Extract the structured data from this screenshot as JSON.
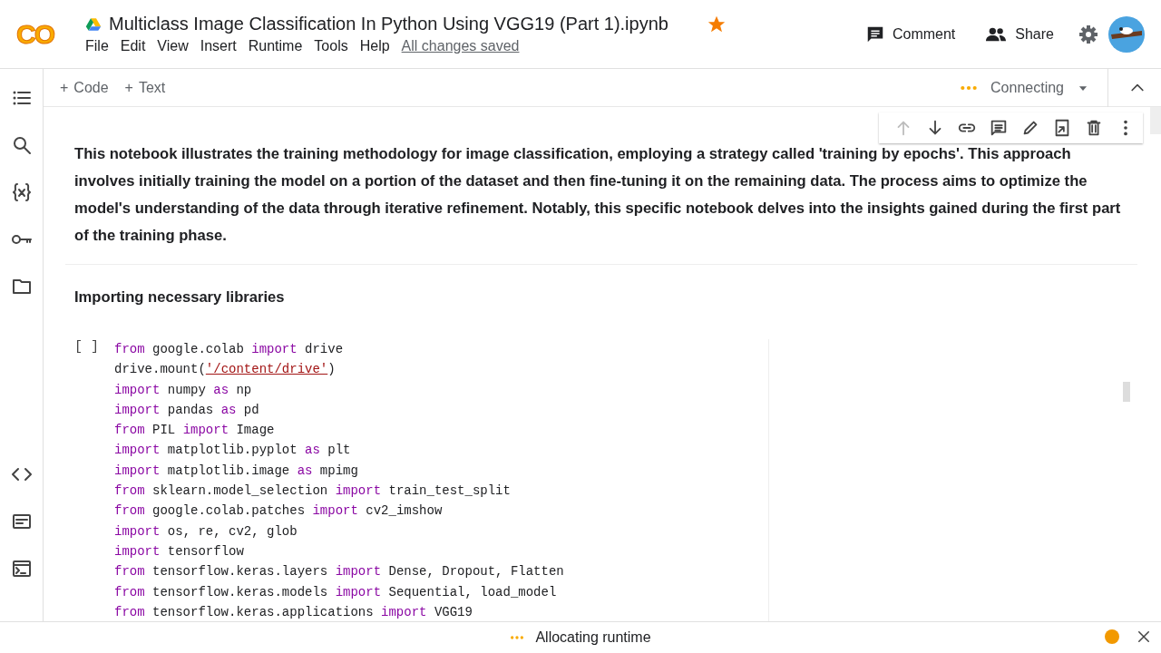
{
  "header": {
    "logo": "CO",
    "title": "Multiclass Image Classification In Python Using VGG19 (Part 1).ipynb",
    "starred": true,
    "menu": [
      "File",
      "Edit",
      "View",
      "Insert",
      "Runtime",
      "Tools",
      "Help"
    ],
    "save_status": "All changes saved",
    "actions": [
      {
        "kind": "comment",
        "label": "Comment"
      },
      {
        "kind": "share",
        "label": "Share"
      }
    ]
  },
  "toolbar": {
    "buttons": [
      {
        "icon": "+",
        "label": "Code"
      },
      {
        "icon": "+",
        "label": "Text"
      }
    ],
    "runtime": "Connecting"
  },
  "cell_toolbar": [
    {
      "kind": "up",
      "disabled": true
    },
    {
      "kind": "down",
      "disabled": false
    },
    {
      "kind": "link",
      "disabled": false
    },
    {
      "kind": "comment",
      "disabled": false
    },
    {
      "kind": "edit",
      "disabled": false
    },
    {
      "kind": "mirror",
      "disabled": false
    },
    {
      "kind": "delete",
      "disabled": false
    },
    {
      "kind": "more",
      "disabled": false
    }
  ],
  "text_cell": "This notebook illustrates the training methodology for image classification, employing a strategy called 'training by epochs'. This approach involves initially training the model on a portion of the dataset and then fine-tuning it on the remaining data. The process aims to optimize the model's understanding of the data through iterative refinement. Notably, this specific notebook delves into the insights gained during the first part of the training phase.",
  "heading": "Importing necessary libraries",
  "code_cell": {
    "run_label": "[ ]",
    "lines": [
      [
        {
          "kind": "kw",
          "text": "from"
        },
        {
          "kind": "plain",
          "text": " google.colab "
        },
        {
          "kind": "kw",
          "text": "import"
        },
        {
          "kind": "plain",
          "text": " drive"
        }
      ],
      [
        {
          "kind": "plain",
          "text": "drive.mount("
        },
        {
          "kind": "str",
          "text": "'/content/drive'"
        },
        {
          "kind": "plain",
          "text": ")"
        }
      ],
      [
        {
          "kind": "kw",
          "text": "import"
        },
        {
          "kind": "plain",
          "text": " numpy "
        },
        {
          "kind": "kw",
          "text": "as"
        },
        {
          "kind": "plain",
          "text": " np"
        }
      ],
      [
        {
          "kind": "kw",
          "text": "import"
        },
        {
          "kind": "plain",
          "text": " pandas "
        },
        {
          "kind": "kw",
          "text": "as"
        },
        {
          "kind": "plain",
          "text": " pd"
        }
      ],
      [
        {
          "kind": "kw",
          "text": "from"
        },
        {
          "kind": "plain",
          "text": " PIL "
        },
        {
          "kind": "kw",
          "text": "import"
        },
        {
          "kind": "plain",
          "text": " Image"
        }
      ],
      [
        {
          "kind": "kw",
          "text": "import"
        },
        {
          "kind": "plain",
          "text": " matplotlib.pyplot "
        },
        {
          "kind": "kw",
          "text": "as"
        },
        {
          "kind": "plain",
          "text": " plt"
        }
      ],
      [
        {
          "kind": "kw",
          "text": "import"
        },
        {
          "kind": "plain",
          "text": " matplotlib.image "
        },
        {
          "kind": "kw",
          "text": "as"
        },
        {
          "kind": "plain",
          "text": " mpimg"
        }
      ],
      [
        {
          "kind": "kw",
          "text": "from"
        },
        {
          "kind": "plain",
          "text": " sklearn.model_selection "
        },
        {
          "kind": "kw",
          "text": "import"
        },
        {
          "kind": "plain",
          "text": " train_test_split"
        }
      ],
      [
        {
          "kind": "kw",
          "text": "from"
        },
        {
          "kind": "plain",
          "text": " google.colab.patches "
        },
        {
          "kind": "kw",
          "text": "import"
        },
        {
          "kind": "plain",
          "text": " cv2_imshow"
        }
      ],
      [
        {
          "kind": "kw",
          "text": "import"
        },
        {
          "kind": "plain",
          "text": " os, re, cv2, glob"
        }
      ],
      [
        {
          "kind": "kw",
          "text": "import"
        },
        {
          "kind": "plain",
          "text": " tensorflow"
        }
      ],
      [
        {
          "kind": "kw",
          "text": "from"
        },
        {
          "kind": "plain",
          "text": " tensorflow.keras.layers "
        },
        {
          "kind": "kw",
          "text": "import"
        },
        {
          "kind": "plain",
          "text": " Dense, Dropout, Flatten"
        }
      ],
      [
        {
          "kind": "kw",
          "text": "from"
        },
        {
          "kind": "plain",
          "text": " tensorflow.keras.models "
        },
        {
          "kind": "kw",
          "text": "import"
        },
        {
          "kind": "plain",
          "text": " Sequential, load_model"
        }
      ],
      [
        {
          "kind": "kw",
          "text": "from"
        },
        {
          "kind": "plain",
          "text": " tensorflow.keras.applications "
        },
        {
          "kind": "kw",
          "text": "import"
        },
        {
          "kind": "plain",
          "text": " VGG19"
        }
      ]
    ]
  },
  "status_bar": {
    "text": "Allocating runtime"
  }
}
